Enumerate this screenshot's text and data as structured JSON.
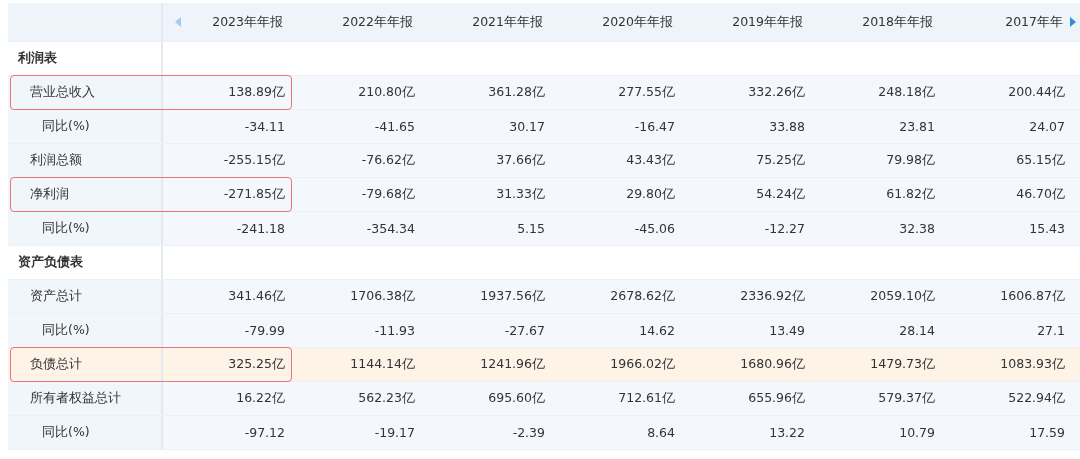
{
  "table": {
    "columns": [
      "2023年年报",
      "2022年年报",
      "2021年年报",
      "2020年年报",
      "2019年年报",
      "2018年年报",
      "2017年年"
    ],
    "rows": [
      {
        "kind": "section",
        "label": "利润表",
        "values": [],
        "highlighted": false,
        "outlined": false
      },
      {
        "kind": "metric",
        "label": "营业总收入",
        "values": [
          "138.89亿",
          "210.80亿",
          "361.28亿",
          "277.55亿",
          "332.26亿",
          "248.18亿",
          "200.44亿"
        ],
        "highlighted": false,
        "outlined": true
      },
      {
        "kind": "ratio",
        "label": "同比(%)",
        "values": [
          "-34.11",
          "-41.65",
          "30.17",
          "-16.47",
          "33.88",
          "23.81",
          "24.07"
        ],
        "highlighted": false,
        "outlined": false
      },
      {
        "kind": "metric",
        "label": "利润总额",
        "values": [
          "-255.15亿",
          "-76.62亿",
          "37.66亿",
          "43.43亿",
          "75.25亿",
          "79.98亿",
          "65.15亿"
        ],
        "highlighted": false,
        "outlined": false
      },
      {
        "kind": "metric",
        "label": "净利润",
        "values": [
          "-271.85亿",
          "-79.68亿",
          "31.33亿",
          "29.80亿",
          "54.24亿",
          "61.82亿",
          "46.70亿"
        ],
        "highlighted": false,
        "outlined": true
      },
      {
        "kind": "ratio",
        "label": "同比(%)",
        "values": [
          "-241.18",
          "-354.34",
          "5.15",
          "-45.06",
          "-12.27",
          "32.38",
          "15.43"
        ],
        "highlighted": false,
        "outlined": false
      },
      {
        "kind": "section",
        "label": "资产负债表",
        "values": [],
        "highlighted": false,
        "outlined": false
      },
      {
        "kind": "metric",
        "label": "资产总计",
        "values": [
          "341.46亿",
          "1706.38亿",
          "1937.56亿",
          "2678.62亿",
          "2336.92亿",
          "2059.10亿",
          "1606.87亿"
        ],
        "highlighted": false,
        "outlined": false
      },
      {
        "kind": "ratio",
        "label": "同比(%)",
        "values": [
          "-79.99",
          "-11.93",
          "-27.67",
          "14.62",
          "13.49",
          "28.14",
          "27.1"
        ],
        "highlighted": false,
        "outlined": false
      },
      {
        "kind": "metric",
        "label": "负债总计",
        "values": [
          "325.25亿",
          "1144.14亿",
          "1241.96亿",
          "1966.02亿",
          "1680.96亿",
          "1479.73亿",
          "1083.93亿"
        ],
        "highlighted": true,
        "outlined": true
      },
      {
        "kind": "metric",
        "label": "所有者权益总计",
        "values": [
          "16.22亿",
          "562.23亿",
          "695.60亿",
          "712.61亿",
          "655.96亿",
          "579.37亿",
          "522.94亿"
        ],
        "highlighted": false,
        "outlined": false
      },
      {
        "kind": "ratio",
        "label": "同比(%)",
        "values": [
          "-97.12",
          "-19.17",
          "-2.39",
          "8.64",
          "13.22",
          "10.79",
          "17.59"
        ],
        "highlighted": false,
        "outlined": false
      }
    ]
  }
}
